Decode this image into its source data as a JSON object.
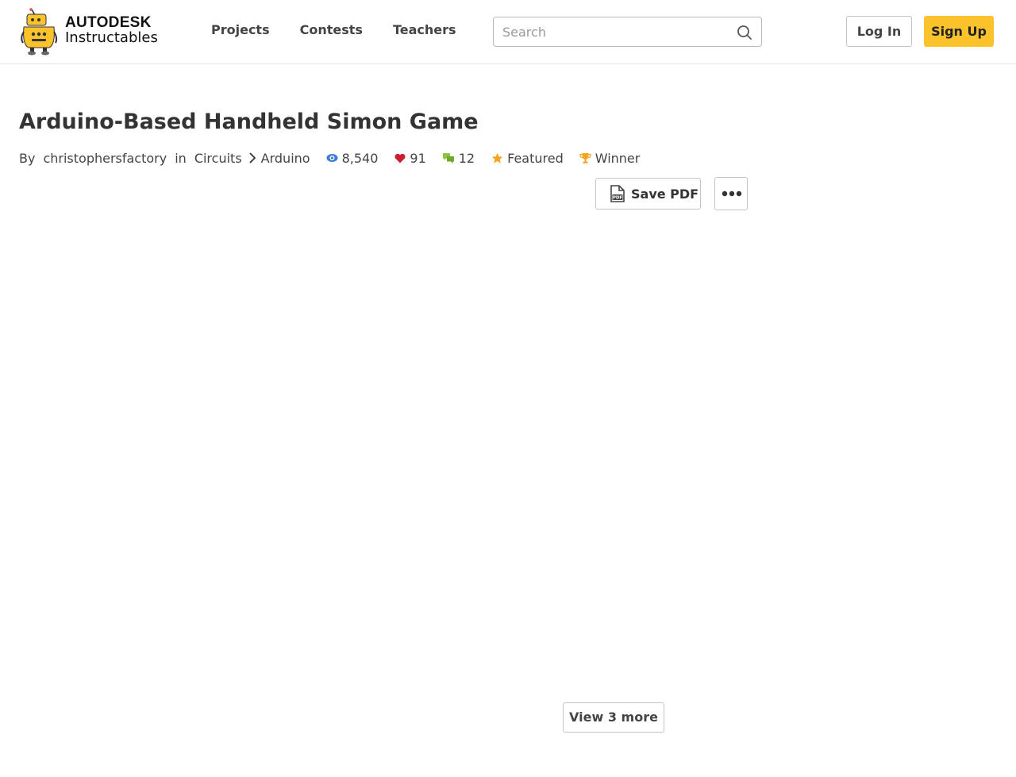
{
  "header": {
    "logo": {
      "line1": "AUTODESK",
      "line2": "Instructables",
      "accent": "#fac22b"
    },
    "nav": [
      {
        "label": "Projects"
      },
      {
        "label": "Contests"
      },
      {
        "label": "Teachers"
      }
    ],
    "search": {
      "placeholder": "Search",
      "value": ""
    },
    "login_label": "Log In",
    "signup_label": "Sign Up"
  },
  "article": {
    "title": "Arduino-Based Handheld Simon Game",
    "by": "By",
    "author": "christophersfactory",
    "in": "in",
    "category": "Circuits",
    "subcategory": "Arduino",
    "stats": {
      "views": "8,540",
      "favorites": "91",
      "comments": "12",
      "featured": "Featured",
      "winner": "Winner"
    },
    "save_pdf_label": "Save PDF",
    "view_more_label": "View 3 more"
  },
  "colors": {
    "brand_yellow": "#fac22b",
    "views_icon": "#3b7bd6",
    "favorite_icon": "#c8202f",
    "comments_icon": "#8cc63e",
    "featured_icon": "#f6a623",
    "winner_icon": "#f6a623"
  }
}
